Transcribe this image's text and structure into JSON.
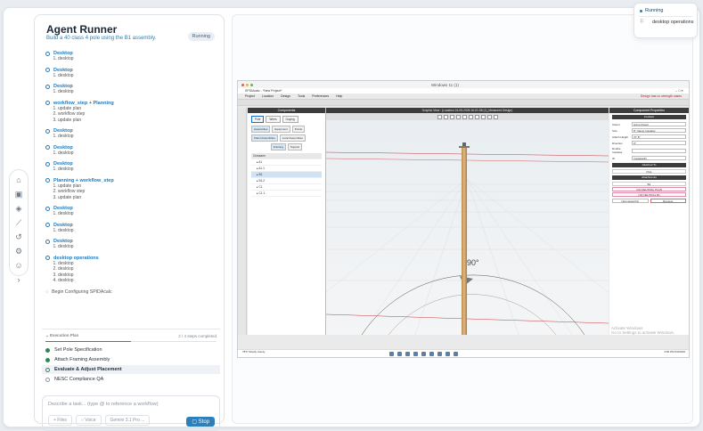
{
  "agent": {
    "title": "Agent Runner",
    "subtitle": "Build a 40 class 4 pole using the B1 assembly.",
    "status": "Running",
    "steps": [
      {
        "title": "Desktop",
        "items": [
          "desktop"
        ]
      },
      {
        "title": "Desktop",
        "items": [
          "desktop"
        ]
      },
      {
        "title": "Desktop",
        "items": [
          "desktop"
        ]
      },
      {
        "title": "workflow_step + Planning",
        "items": [
          "update plan",
          "workflow step",
          "update plan"
        ]
      },
      {
        "title": "Desktop",
        "items": [
          "desktop"
        ]
      },
      {
        "title": "Desktop",
        "items": [
          "desktop"
        ]
      },
      {
        "title": "Desktop",
        "items": [
          "desktop"
        ]
      },
      {
        "title": "Planning + workflow_step",
        "items": [
          "update plan",
          "workflow step",
          "update plan"
        ]
      },
      {
        "title": "Desktop",
        "items": [
          "desktop"
        ]
      },
      {
        "title": "Desktop",
        "items": [
          "desktop"
        ]
      },
      {
        "title": "Desktop",
        "items": [
          "desktop"
        ]
      },
      {
        "title": "desktop operations",
        "items": [
          "desktop",
          "desktop",
          "desktop",
          "desktop"
        ]
      }
    ],
    "begin_text": "Begin Configuring SPIDAcalc"
  },
  "plan": {
    "title": "Execution Plan",
    "progress_text": "2 / 4 steps completed",
    "progress": 0.5,
    "items": [
      {
        "label": "Set Pole Specification",
        "state": "done"
      },
      {
        "label": "Attach Framing Assembly",
        "state": "done"
      },
      {
        "label": "Evaluate & Adjust Placement",
        "state": "current"
      },
      {
        "label": "NESC Compliance QA",
        "state": "todo"
      }
    ]
  },
  "composer": {
    "placeholder": "Describe a task... (type @ to reference a workflow)",
    "files": "+ Files",
    "voice": "○ Voice",
    "model": "Gemini 3.1 Pro ...",
    "stop": "Stop"
  },
  "toast": {
    "status": "Running",
    "label": "desktop operations"
  },
  "remote": {
    "window_title": "Windows 11 (1)",
    "app_title": "SPIDAcalc - *New Project*",
    "menu": [
      "Project",
      "Location",
      "Design",
      "Tools",
      "Preferences",
      "Help"
    ],
    "menu_right": "Design has no strength cases",
    "components_title": "Components",
    "comp_tabs": [
      "Pole",
      "Wires",
      "Guying"
    ],
    "comp_tabs2": [
      "Assemblies",
      "Equipment",
      "Points"
    ],
    "comp_tabs3": [
      "Client Assemblies",
      "Local Assemblies"
    ],
    "comp_tabs4": [
      "Framing",
      "Support"
    ],
    "tree_header": "Crossarm",
    "tree": [
      "A1",
      "A1.1",
      "B1",
      "B1.2",
      "C1",
      "C1.1"
    ],
    "tree_selected": "B1",
    "graphic_title": "Graphic View · (Location 24-05-2026 16-01-58 (1)_Measured Design)",
    "props_title": "Component Properties",
    "props_section": "Insulator",
    "props": [
      {
        "k": "Owner",
        "v": "Acme Power"
      },
      {
        "k": "Size",
        "v": "8\" Clamp Insulator"
      },
      {
        "k": "Attach Height",
        "v": "37'   8\""
      },
      {
        "k": "Direction",
        "v": "0°"
      },
      {
        "k": "Double Insulator",
        "v": ""
      },
      {
        "k": "ID",
        "v": "Insulator#1"
      }
    ],
    "attached_to": "Attached To",
    "attached_val": "Pole",
    "attachments": "Attachments",
    "attach_items": [
      "B1",
      "(10) NEUTRAL  PLAN",
      "(10) NEUTRAL  B1"
    ],
    "new_assembly": "New assembly",
    "delete": "Remove",
    "angle": "90°",
    "taskbar_left": "78°F Mostly cloudy",
    "taskbar_right": "4:56 PM 5/3/2026",
    "activate": [
      "Activate Windows",
      "Go to Settings to activate Windows."
    ]
  }
}
